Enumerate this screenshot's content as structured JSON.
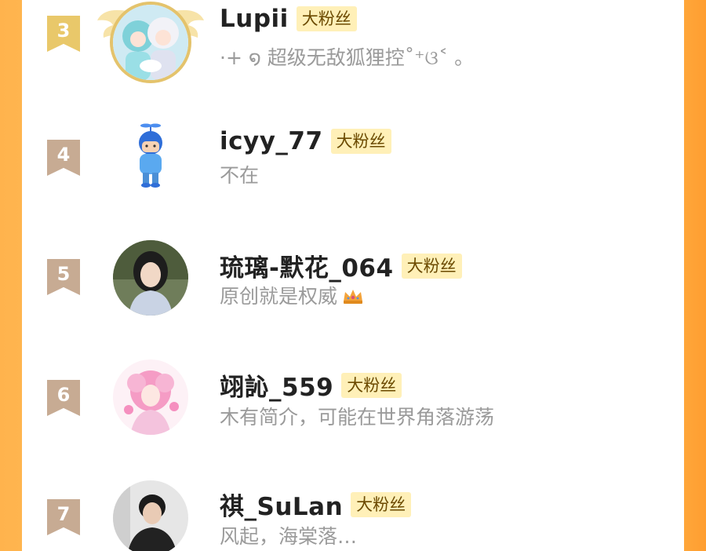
{
  "fans": [
    {
      "rank": "3",
      "username": "Lupii",
      "badge": "大粉丝",
      "bio": "·+ ໑ 超级无敌狐狸控˚⁺ଓ˂ 。",
      "rank_color": "#e9c86a"
    },
    {
      "rank": "4",
      "username": "icyy_77",
      "badge": "大粉丝",
      "bio": "不在",
      "rank_color": "#c7ab93"
    },
    {
      "rank": "5",
      "username": "琉璃-默花_064",
      "badge": "大粉丝",
      "bio": "原创就是权威",
      "rank_color": "#c7ab93"
    },
    {
      "rank": "6",
      "username": "翊訫_559",
      "badge": "大粉丝",
      "bio": "木有简介，可能在世界角落游荡",
      "rank_color": "#c7ab93"
    },
    {
      "rank": "7",
      "username": "祺_SuLan",
      "badge": "大粉丝",
      "bio": "风起，海棠落…",
      "rank_color": "#c7ab93"
    }
  ],
  "colors": {
    "side_left": "#ffb34d",
    "side_right": "#ffa63a",
    "badge_bg": "#fff0b8",
    "bio_text": "#9a9a9a"
  }
}
